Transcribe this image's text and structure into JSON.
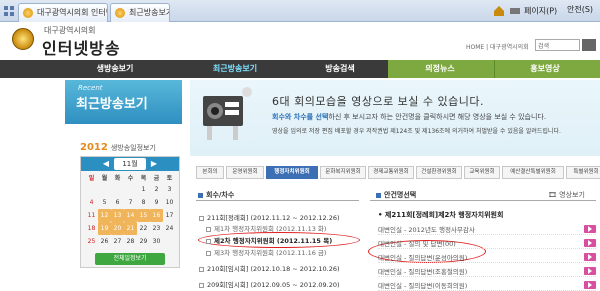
{
  "browser": {
    "tab1": "대구광역시의회 인터넷방송 ...",
    "tab2": "최근방송보기",
    "right_page": "페이지(P)",
    "right_tools": "안전(S)"
  },
  "header": {
    "org": "대구광역시의회",
    "title": "인터넷방송",
    "util_links": "HOME  |  대구광역시의회",
    "search_value": "검색"
  },
  "nav": {
    "items": [
      "생방송보기",
      "최근방송보기",
      "방송검색",
      "의정뉴스",
      "홍보영상"
    ],
    "active_index": 1
  },
  "sidebar": {
    "recent_en": "Recent",
    "recent_ko": "최근방송보기",
    "cal_year": "2012",
    "cal_label": "생방송일정보기",
    "cal_month": "11월",
    "cal_prev": "◀",
    "cal_next": "▶",
    "weekdays": [
      "일",
      "월",
      "화",
      "수",
      "목",
      "금",
      "토"
    ],
    "weeks": [
      [
        "",
        "",
        "",
        "",
        "1",
        "2",
        "3"
      ],
      [
        "4",
        "5",
        "6",
        "7",
        "8",
        "9",
        "10"
      ],
      [
        "11",
        "12",
        "13",
        "14",
        "15",
        "16",
        "17"
      ],
      [
        "18",
        "19",
        "20",
        "21",
        "22",
        "23",
        "24"
      ],
      [
        "25",
        "26",
        "27",
        "28",
        "29",
        "30",
        ""
      ]
    ],
    "highlighted_days": [
      "12",
      "13",
      "14",
      "15",
      "16",
      "19",
      "20",
      "21"
    ],
    "cal_full_button": "전체일정보기"
  },
  "banner": {
    "title": "6대 회의모습을 영상으로 보실 수 있습니다.",
    "line1_em": "회수와 차수를 선택",
    "line1_rest": "하신 후 보시고자 하는 안건명을 클릭하시면 해당 영상을 보실 수 있습니다.",
    "line2": "영상을 임의로 저장 편집 배포할 경우 저작권법 제124조 및 제136조에 의거하여 처벌받을 수 있음을 알려드립니다."
  },
  "committee_tabs": [
    "본회의",
    "운영위원회",
    "행정자치위원회",
    "문화복지위원회",
    "경제교통위원회",
    "건설환경위원회",
    "교육위원회",
    "예산결산특별위원회",
    "특별위원회"
  ],
  "committee_active": 2,
  "sessions": {
    "header": "회수/차수",
    "rows": [
      {
        "text": "211회[정례회] (2012.11.12 ~ 2012.12.26)",
        "bold": false,
        "sub": false
      },
      {
        "text": "제1차 행정자치위원회 (2012.11.13 화)",
        "bold": false,
        "sub": true
      },
      {
        "text": "제2차 행정자치위원회 (2012.11.15 목)",
        "bold": true,
        "sub": true
      },
      {
        "text": "제3차 행정자치위원회 (2012.11.16 금)",
        "bold": false,
        "sub": true
      },
      {
        "text": "210회[임시회] (2012.10.18 ~ 2012.10.26)",
        "bold": false,
        "sub": false
      },
      {
        "text": "209회[임시회] (2012.09.05 ~ 2012.09.20)",
        "bold": false,
        "sub": false
      }
    ]
  },
  "agenda": {
    "header": "안건명선택",
    "view_link": "영상보기",
    "title": "• 제211회[정례회]제2차 행정자치위원회",
    "rows": [
      "대변인실 - 2012년도 행정사무감사",
      "대변인실 - 질의 및 답변(00)",
      "대변인실 - 질의답변(윤성아의원)",
      "대변인실 - 질의답변(조홍철의원)",
      "대변인실 - 질의답변(이동희의원)"
    ]
  },
  "colors": {
    "nav_bg": "#3a3a3a",
    "nav_accent": "#7ea840",
    "recent_box": "#2f8fc0",
    "tab_active": "#3d6fb5",
    "highlight_circle": "#e02020"
  }
}
